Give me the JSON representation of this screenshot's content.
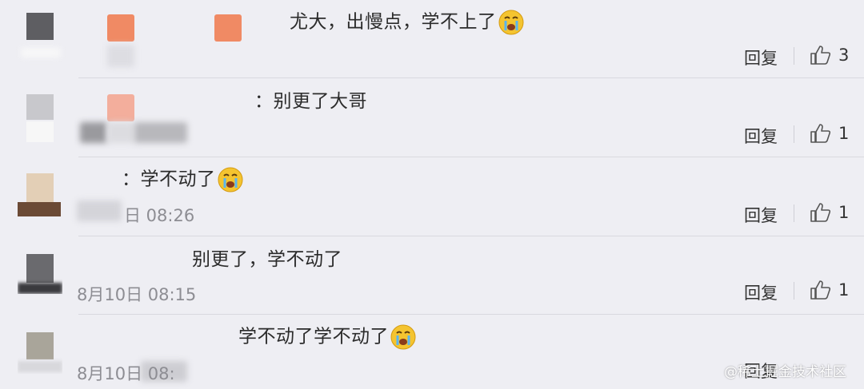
{
  "comments": [
    {
      "text": "尤大，出慢点，学不上了",
      "emoji": "crying-face",
      "time": "",
      "reply_label": "回复",
      "likes": "3"
    },
    {
      "text": "：别更了大哥",
      "emoji": "",
      "time": "",
      "reply_label": "回复",
      "likes": "1"
    },
    {
      "text": "：学不动了",
      "emoji": "crying-face",
      "time": "日 08:26",
      "reply_label": "回复",
      "likes": "1"
    },
    {
      "text": "别更了，学不动了",
      "emoji": "",
      "time": "8月10日 08:15",
      "reply_label": "回复",
      "likes": "1"
    },
    {
      "text": "学不动了学不动了",
      "emoji": "crying-face",
      "time": "8月10日 08:",
      "reply_label": "回复",
      "likes": ""
    }
  ],
  "watermark": "@稀土掘金技术社区",
  "colors": {
    "background": "#eeeef3",
    "text": "#2b2b2b",
    "time": "#8d8d93",
    "divider": "#d9d9df",
    "emoji": "#f4c430"
  }
}
